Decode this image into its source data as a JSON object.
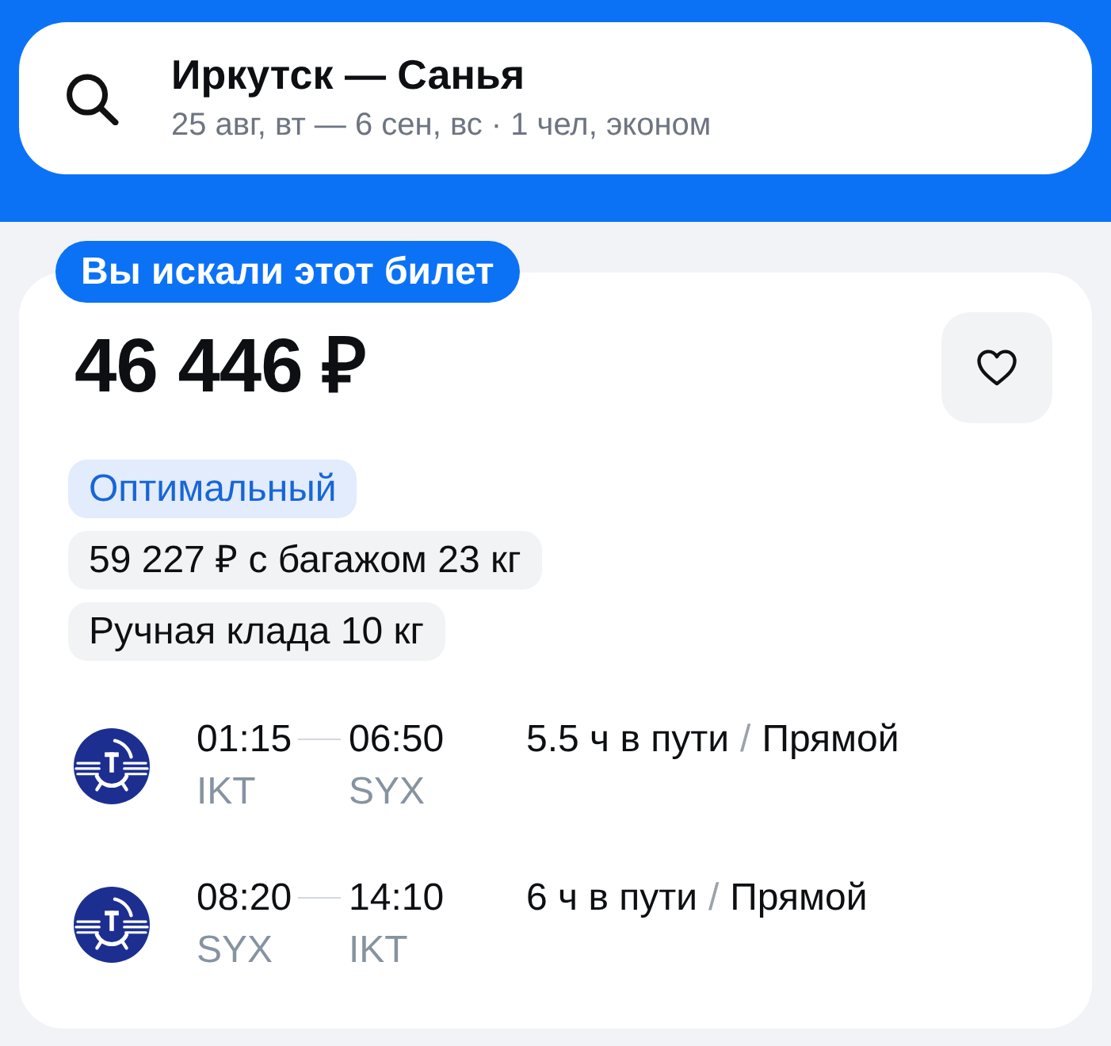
{
  "search": {
    "route": "Иркутск — Санья",
    "details": "25 авг, вт — 6 сен, вс · 1 чел, эконом"
  },
  "ticket": {
    "badge": "Вы искали этот билет",
    "price": "46 446 ₽",
    "saved": false,
    "tags": [
      {
        "kind": "highlight",
        "text": "Оптимальный"
      },
      {
        "kind": "plain",
        "text": "59 227 ₽ с багажом 23 кг"
      },
      {
        "kind": "plain",
        "text": "Ручная клада 10 кг"
      }
    ],
    "flights": [
      {
        "departure_time": "01:15",
        "arrival_time": "06:50",
        "departure_code": "IKT",
        "arrival_code": "SYX",
        "duration": "5.5 ч в пути",
        "separator": "/",
        "stops": "Прямой"
      },
      {
        "departure_time": "08:20",
        "arrival_time": "14:10",
        "departure_code": "SYX",
        "arrival_code": "IKT",
        "duration": "6 ч в пути",
        "separator": "/",
        "stops": "Прямой"
      }
    ]
  }
}
